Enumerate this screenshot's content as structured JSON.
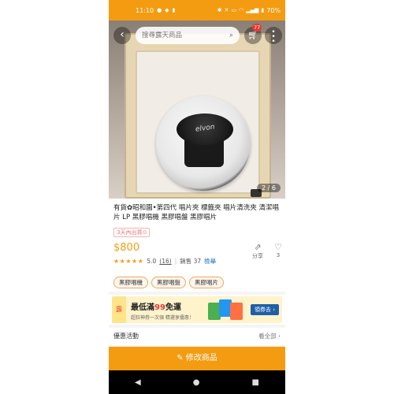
{
  "status_bar": {
    "time": "11:10",
    "battery": "70%"
  },
  "header": {
    "search_placeholder": "搜尋露天商品",
    "cart_count": "77"
  },
  "gallery": {
    "counter": "2 / 6",
    "logo_text": "elvon"
  },
  "product": {
    "title": "有貨✿昭和園•第四代 唱片夾 標籤夾 唱片清洗夾 清潔唱片 LP 黑膠唱機 黑膠唱盤 黑膠唱片",
    "ship_tag": "3天內出貨⊙",
    "price": "$800",
    "stars": "★★★★★",
    "rating": "5.0",
    "review_count": "(16)",
    "sold": "銷售 37",
    "report": "檢舉",
    "share_label": "分享",
    "like_count": "3",
    "tags": [
      "黑膠唱機",
      "黑膠唱盤",
      "黑膠唱片"
    ]
  },
  "banner": {
    "logo": "露",
    "text_pre": "最低滿",
    "text_big": "99",
    "text_post": "免運",
    "subtext": "超狂神券一次領 精選享優惠！",
    "button": "領券去 ›"
  },
  "promo": {
    "label": "優惠活動",
    "see_all": "看全部 ›"
  },
  "action": {
    "edit_label": "✎ 修改商品"
  },
  "nav": {
    "back": "◀",
    "home": "●",
    "recent": "■"
  },
  "colors": {
    "brand_orange": "#f39c12",
    "report_blue": "#1e73be"
  }
}
